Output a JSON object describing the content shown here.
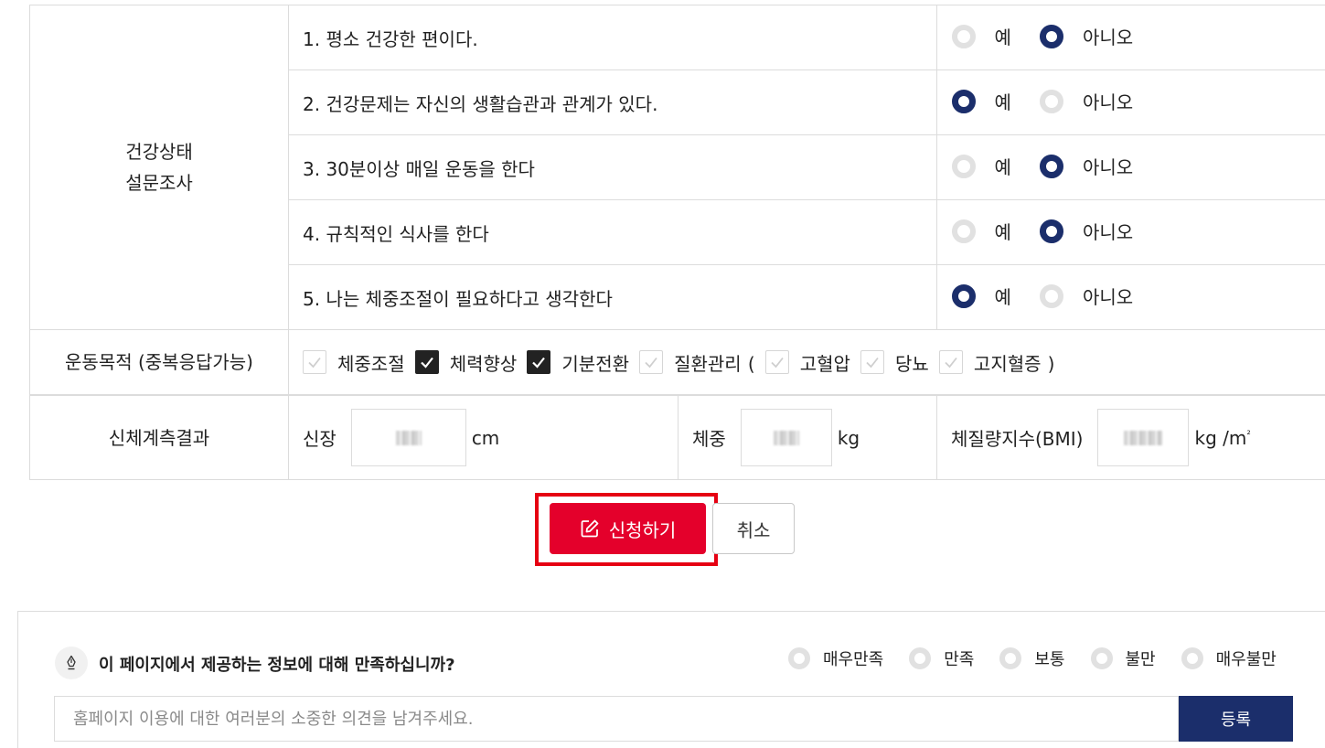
{
  "survey": {
    "section_label_line1": "건강상태",
    "section_label_line2": "설문조사",
    "yes_label": "예",
    "no_label": "아니오",
    "questions": [
      {
        "text": "1. 평소 건강한 편이다.",
        "answer": "no"
      },
      {
        "text": "2. 건강문제는 자신의 생활습관과 관계가 있다.",
        "answer": "yes"
      },
      {
        "text": "3. 30분이상 매일 운동을 한다",
        "answer": "no"
      },
      {
        "text": "4. 규칙적인 식사를 한다",
        "answer": "no"
      },
      {
        "text": "5. 나는 체중조절이 필요하다고 생각한다",
        "answer": "yes"
      }
    ]
  },
  "purpose": {
    "label": "운동목적 (중복응답가능)",
    "options": [
      {
        "label": "체중조절",
        "checked": false
      },
      {
        "label": "체력향상",
        "checked": true
      },
      {
        "label": "기분전환",
        "checked": true
      },
      {
        "label": "질환관리",
        "checked": false
      },
      {
        "label": "고혈압",
        "checked": false
      },
      {
        "label": "당뇨",
        "checked": false
      },
      {
        "label": "고지혈증",
        "checked": false
      }
    ],
    "paren_open": "(",
    "paren_close": ")"
  },
  "measurement": {
    "label": "신체계측결과",
    "height_label": "신장",
    "height_unit": "cm",
    "weight_label": "체중",
    "weight_unit": "kg",
    "bmi_label": "체질량지수(BMI)",
    "bmi_unit": "kg /m",
    "bmi_unit_sup": "²"
  },
  "actions": {
    "apply_label": "신청하기",
    "cancel_label": "취소",
    "highlight_color": "#e60012",
    "apply_color": "#e4002b"
  },
  "feedback": {
    "question": "이 페이지에서 제공하는 정보에 대해 만족하십니까?",
    "options": [
      "매우만족",
      "만족",
      "보통",
      "불만",
      "매우불만"
    ],
    "input_placeholder": "홈페이지 이용에 대한 여러분의 소중한 의견을 남겨주세요.",
    "submit_label": "등록",
    "accent_color": "#1b2e6b"
  }
}
